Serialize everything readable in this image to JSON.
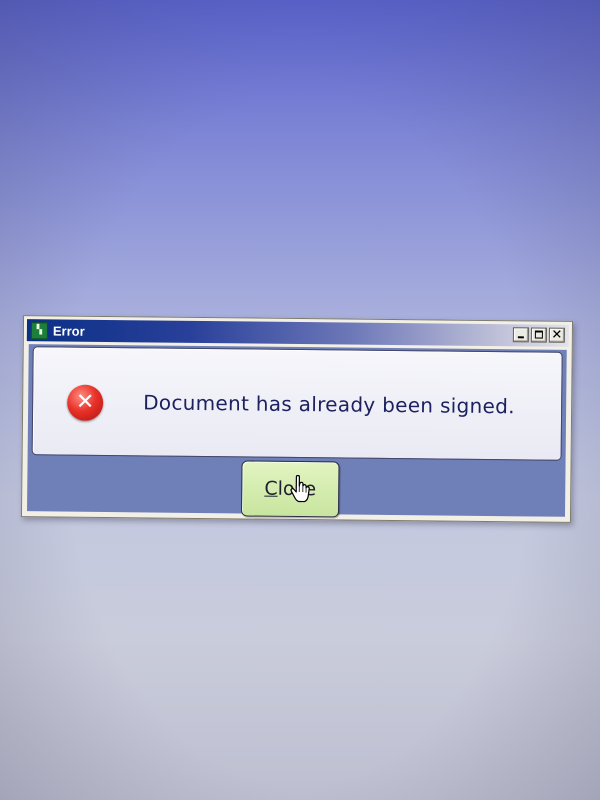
{
  "window": {
    "title": "Error",
    "app_icon": "app-icon",
    "controls": {
      "minimize": "minimize-icon",
      "maximize": "maximize-icon",
      "close": "close-icon",
      "close_glyph": "✕"
    }
  },
  "message": {
    "icon": "error-icon",
    "icon_glyph": "✕",
    "text": "Document has already been signed."
  },
  "close_button": {
    "accel": "C",
    "rest": "lose"
  },
  "cursor": "hand-cursor",
  "colors": {
    "titlebar_start": "#0b2f86",
    "body_background": "#6f7fb8",
    "button_fill": "#c8e59e",
    "error_red": "#e8322a",
    "message_text": "#1d2160"
  }
}
